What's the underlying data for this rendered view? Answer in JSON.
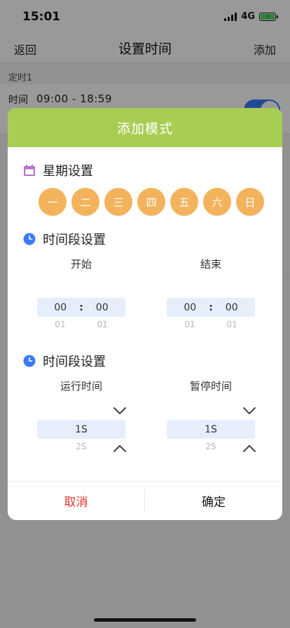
{
  "status_bar": {
    "time": "15:01",
    "network": "4G"
  },
  "nav": {
    "back_label": "返回",
    "title": "设置时间",
    "add_label": "添加"
  },
  "timer": {
    "section_label": "定时1",
    "time_label": "时间",
    "time_value": "09:00 - 18:59",
    "enabled": true
  },
  "modal": {
    "title": "添加模式",
    "week_section": {
      "title": "星期设置",
      "days": [
        "一",
        "二",
        "三",
        "四",
        "五",
        "六",
        "日"
      ]
    },
    "period_section": {
      "title": "时间段设置",
      "start": {
        "label": "开始",
        "hour": "00",
        "minute": "00",
        "next_hour": "01",
        "next_minute": "01"
      },
      "end": {
        "label": "结束",
        "hour": "00",
        "minute": "00",
        "next_hour": "01",
        "next_minute": "01"
      }
    },
    "run_section": {
      "title": "时间段设置",
      "run": {
        "label": "运行时间",
        "value": "1S",
        "next": "2S"
      },
      "pause": {
        "label": "暂停时间",
        "value": "1S",
        "next": "2S"
      }
    },
    "cancel_label": "取消",
    "confirm_label": "确定"
  },
  "colors": {
    "header": "#a7cd52",
    "day_circle": "#f3b35d",
    "cancel": "#e5352b",
    "picker_bg": "#e6eefb",
    "clock": "#3a7bfa",
    "calendar": "#b373c9"
  },
  "icons": [
    "calendar-icon",
    "clock-icon",
    "chevron-down-icon",
    "chevron-up-icon"
  ]
}
